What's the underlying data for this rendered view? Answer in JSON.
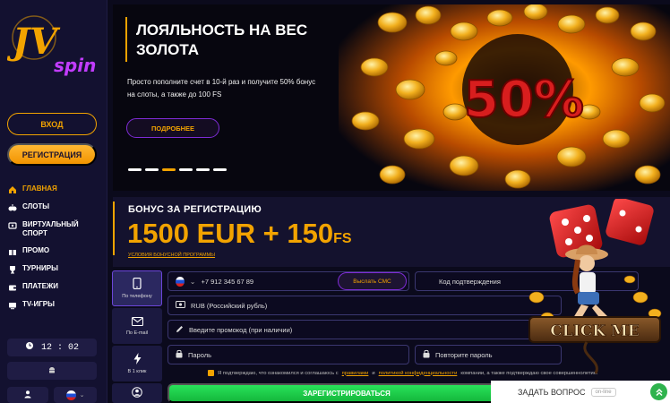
{
  "sidebar": {
    "logo_text": "JVspin",
    "login_label": "ВХОД",
    "register_label": "РЕГИСТРАЦИЯ",
    "nav": [
      {
        "label": "ГЛАВНАЯ",
        "icon": "home-icon"
      },
      {
        "label": "СЛОТЫ",
        "icon": "slots-icon"
      },
      {
        "label": "ВИРТУАЛЬНЫЙ СПОРТ",
        "icon": "virtual-sport-icon"
      },
      {
        "label": "ПРОМО",
        "icon": "promo-icon"
      },
      {
        "label": "ТУРНИРЫ",
        "icon": "trophy-icon"
      },
      {
        "label": "ПЛАТЕЖИ",
        "icon": "wallet-icon"
      },
      {
        "label": "TV-ИГРЫ",
        "icon": "tv-icon"
      }
    ],
    "time": "12 : 02"
  },
  "banner": {
    "title": "ЛОЯЛЬНОСТЬ НА ВЕС ЗОЛОТА",
    "text": "Просто пополните счет в 10-й раз и получите 50% бонус на слоты, а также до 100 FS",
    "button": "ПОДРОБНЕЕ",
    "art_text": "50%",
    "slides": 6,
    "active_slide": 2
  },
  "bonus": {
    "label": "БОНУС ЗА РЕГИСТРАЦИЮ",
    "amount": "1500 EUR + 150",
    "amount_suffix": "FS",
    "link": "УСЛОВИЯ БОНУСНОЙ ПРОГРАММЫ"
  },
  "form": {
    "tabs": [
      {
        "label": "По телефону",
        "icon": "phone-icon"
      },
      {
        "label": "По E-mail",
        "icon": "mail-icon"
      },
      {
        "label": "В 1 клик",
        "icon": "lightning-icon"
      },
      {
        "label": "",
        "icon": "user-icon"
      }
    ],
    "phone_value": "+7 912 345 67 89",
    "sms_button": "Выслать СМС",
    "code_placeholder": "Код подтверждения",
    "currency_value": "RUB (Российский рубль)",
    "promo_placeholder": "Введите промокод (при наличии)",
    "password_placeholder": "Пароль",
    "repeat_password_placeholder": "Повторите пароль",
    "consent_prefix": "Я подтверждаю, что ознакомился и соглашаюсь с",
    "consent_rules": "правилами",
    "consent_and": "и",
    "consent_policy": "политикой конфиденциальности",
    "consent_suffix": "компании, а также подтверждаю свое совершеннолетие.",
    "submit": "ЗАРЕГИСТРИРОВАТЬСЯ"
  },
  "promo_widget": {
    "label": "CLICK ME"
  },
  "chat": {
    "label": "ЗАДАТЬ ВОПРОС",
    "status": "on-line"
  },
  "colors": {
    "accent": "#f2a300",
    "purple": "#7e2bd6",
    "green": "#29e25a",
    "background": "#0b0a1c"
  }
}
